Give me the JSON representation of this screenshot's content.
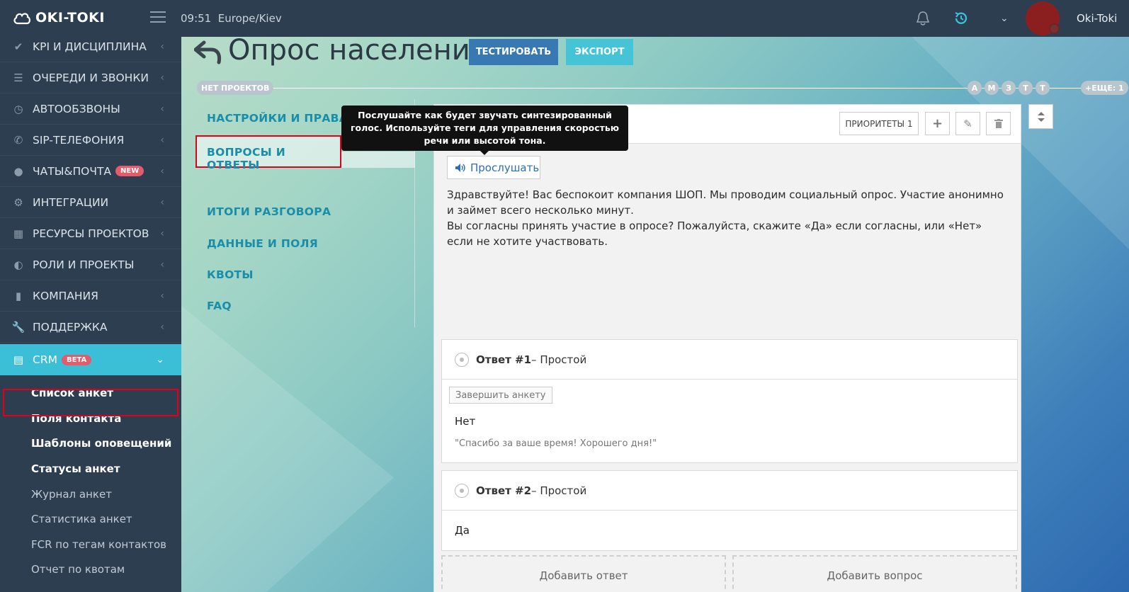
{
  "header": {
    "logo": "OKI-TOKI",
    "time": "09:51",
    "timezone": "Europe/Kiev",
    "user": "Oki-Toki"
  },
  "sidebar": {
    "items": [
      {
        "label": "KPI И ДИСЦИПЛИНА",
        "icon": "check-icon"
      },
      {
        "label": "ОЧЕРЕДИ И ЗВОНКИ",
        "icon": "list-icon"
      },
      {
        "label": "АВТООБЗВОНЫ",
        "icon": "clock-icon"
      },
      {
        "label": "SIP-ТЕЛЕФОНИЯ",
        "icon": "phone-icon"
      },
      {
        "label": "ЧАТЫ&ПОЧТА",
        "icon": "chat-icon",
        "badge": "NEW"
      },
      {
        "label": "ИНТЕГРАЦИИ",
        "icon": "gears-icon"
      },
      {
        "label": "РЕСУРСЫ ПРОЕКТОВ",
        "icon": "grid-icon"
      },
      {
        "label": "РОЛИ И ПРОЕКТЫ",
        "icon": "toggle-icon"
      },
      {
        "label": "КОМПАНИЯ",
        "icon": "chart-icon"
      },
      {
        "label": "ПОДДЕРЖКА",
        "icon": "wrench-icon"
      },
      {
        "label": "CRM",
        "icon": "crm-icon",
        "badge": "BETA"
      }
    ],
    "sub": [
      "Список анкет",
      "Поля контакта",
      "Шаблоны оповещений",
      "Статусы анкет",
      "Журнал анкет",
      "Статистика анкет",
      "FCR по тегам контактов",
      "Отчет по квотам"
    ]
  },
  "page": {
    "title": "Опрос населения",
    "test_btn": "ТЕСТИРОВАТЬ",
    "export_btn": "ЭКСПОРТ"
  },
  "timeline": {
    "left": "НЕТ ПРОЕКТОВ",
    "letters": [
      "А",
      "М",
      "З",
      "Т",
      "Т"
    ],
    "more": "+ЕЩЕ: 1"
  },
  "tabs": [
    "НАСТРОЙКИ И ПРАВА",
    "ВОПРОСЫ И ОТВЕТЫ",
    "ИТОГИ РАЗГОВОРА",
    "ДАННЫЕ И ПОЛЯ",
    "КВОТЫ",
    "FAQ"
  ],
  "tooltip": {
    "text": "Послушайте как будет звучать синтезированный голос. Используйте теги для управления скоростью речи или высотой тона."
  },
  "question": {
    "priorities": "ПРИОРИТЕТЫ 1",
    "listen": "Прослушать",
    "text1": "Здравствуйте! Вас беспокоит компания ШОП. Мы проводим социальный опрос. Участие анонимно и займет всего несколько минут.",
    "text2": "Вы согласны принять участие в опросе? Пожалуйста, скажите «Да» если согласны, или «Нет» если не хотите участвовать."
  },
  "answers": [
    {
      "num": "Ответ #1",
      "type": " – Простой",
      "action": "Завершить анкету",
      "value": "Нет",
      "note": "\"Спасибо за ваше время! Хорошего дня!\""
    },
    {
      "num": "Ответ #2",
      "type": " – Простой",
      "value": "Да"
    }
  ],
  "actions": {
    "add_answer": "Добавить ответ",
    "add_question": "Добавить вопрос"
  }
}
